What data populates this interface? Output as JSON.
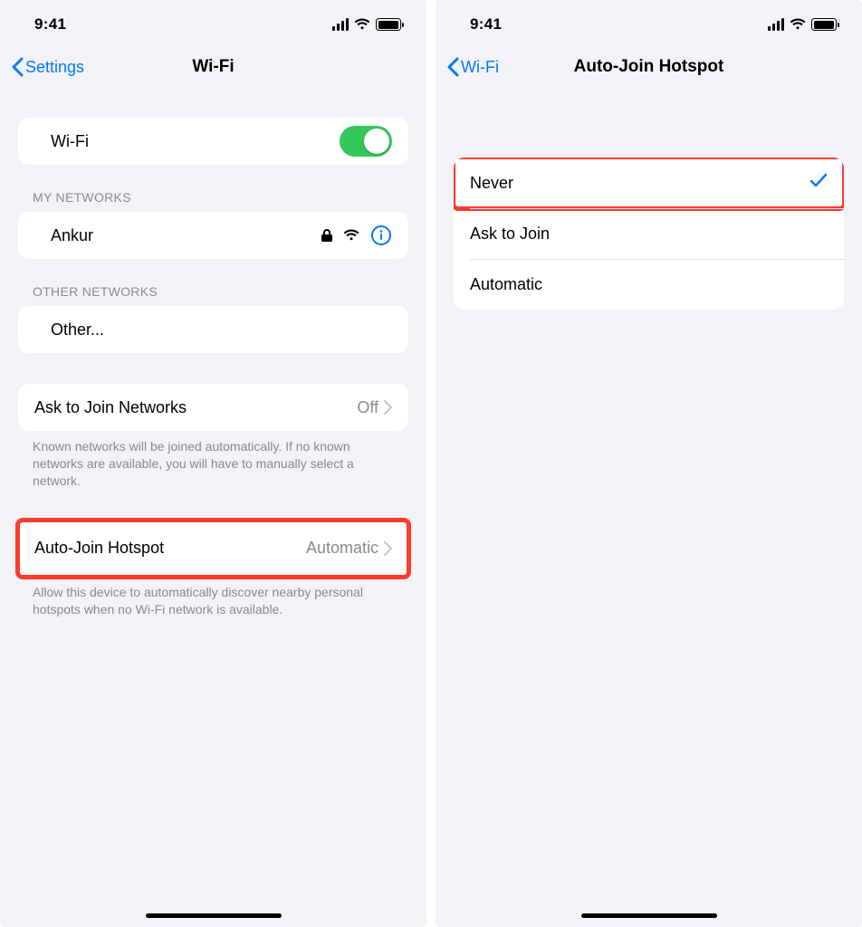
{
  "status": {
    "time": "9:41"
  },
  "left": {
    "nav": {
      "back": "Settings",
      "title": "Wi-Fi"
    },
    "wifi_row": {
      "label": "Wi-Fi"
    },
    "my_networks_header": "MY NETWORKS",
    "network": {
      "name": "Ankur"
    },
    "other_networks_header": "OTHER NETWORKS",
    "other_row": {
      "label": "Other..."
    },
    "ask_row": {
      "label": "Ask to Join Networks",
      "value": "Off"
    },
    "ask_footer": "Known networks will be joined automatically. If no known networks are available, you will have to manually select a network.",
    "hotspot_row": {
      "label": "Auto-Join Hotspot",
      "value": "Automatic"
    },
    "hotspot_footer": "Allow this device to automatically discover nearby personal hotspots when no Wi-Fi network is available."
  },
  "right": {
    "nav": {
      "back": "Wi-Fi",
      "title": "Auto-Join Hotspot"
    },
    "options": [
      {
        "label": "Never",
        "selected": true
      },
      {
        "label": "Ask to Join",
        "selected": false
      },
      {
        "label": "Automatic",
        "selected": false
      }
    ]
  }
}
